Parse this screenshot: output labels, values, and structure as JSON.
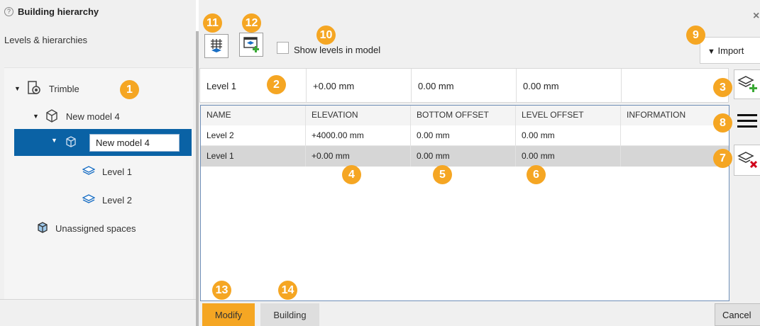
{
  "panel": {
    "title": "Building hierarchy",
    "subtitle": "Levels & hierarchies"
  },
  "tree": {
    "root_label": "Trimble",
    "model_label": "New model 4",
    "selected_edit_value": "New model 4",
    "level_1_label": "Level 1",
    "level_2_label": "Level 2",
    "unassigned_label": "Unassigned spaces"
  },
  "toolbar": {
    "show_levels_label": "Show levels in model",
    "show_levels_checked": false,
    "import_label": "Import"
  },
  "input_row": {
    "name": "Level 1",
    "elevation": "+0.00 mm",
    "bottom_offset": "0.00 mm",
    "level_offset": "0.00 mm",
    "information": ""
  },
  "grid": {
    "columns": [
      "NAME",
      "ELEVATION",
      "BOTTOM OFFSET",
      "LEVEL OFFSET",
      "INFORMATION"
    ],
    "rows": [
      [
        "Level 2",
        "+4000.00 mm",
        "0.00 mm",
        "0.00 mm",
        ""
      ],
      [
        "Level 1",
        "+0.00 mm",
        "0.00 mm",
        "0.00 mm",
        ""
      ]
    ],
    "selected_row": 1
  },
  "tabs": {
    "modify": "Modify",
    "building": "Building"
  },
  "cancel_label": "Cancel",
  "close_glyph": "×",
  "callouts": [
    "1",
    "2",
    "3",
    "4",
    "5",
    "6",
    "7",
    "8",
    "9",
    "10",
    "11",
    "12",
    "13",
    "14"
  ],
  "colors": {
    "accent": "#f5a623",
    "selection": "#0a62a5",
    "layer_icon": "#1a6fc4",
    "delete_red": "#d0021b",
    "add_green": "#3aa935"
  },
  "icons": {
    "trimble": "gear-building-icon",
    "model": "model-cube-icon",
    "level": "layers-icon",
    "unassigned": "box-icon",
    "grid_toggle": "grid-icon",
    "add_hierarchy": "add-window-icon",
    "add_level": "add-layer-icon",
    "menu": "hamburger-icon",
    "delete_level": "delete-layer-icon"
  }
}
